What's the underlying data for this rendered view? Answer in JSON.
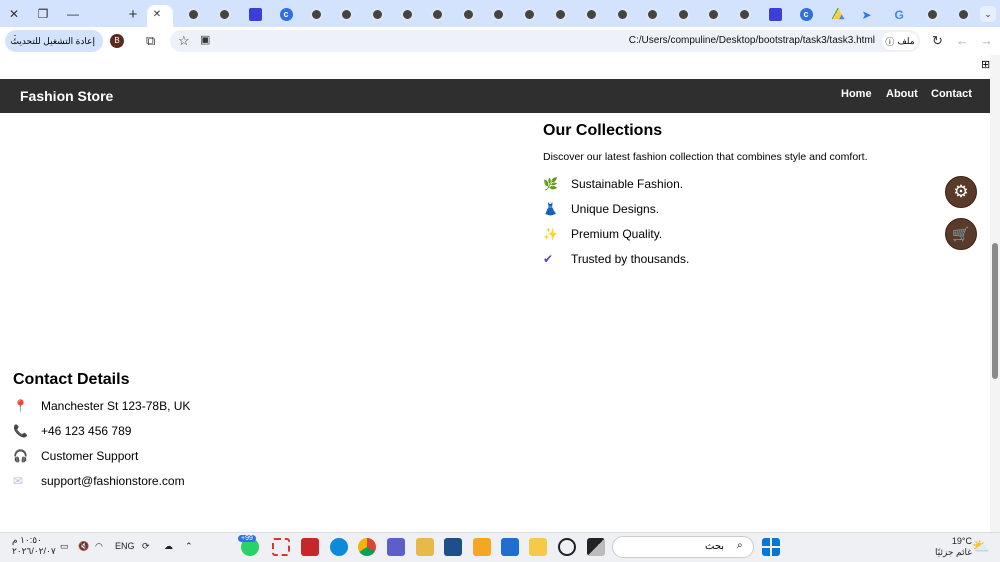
{
  "browser": {
    "window_controls": {
      "close": "✕",
      "restore": "❐",
      "minimize": "—",
      "new_tab": "+"
    },
    "active_tab_close": "✕",
    "tabs": [
      "globe",
      "globe",
      "extension",
      "c-app",
      "globe",
      "globe",
      "globe",
      "globe",
      "globe",
      "globe",
      "globe",
      "globe",
      "globe",
      "globe",
      "globe",
      "globe",
      "globe",
      "globe",
      "globe",
      "extension",
      "c-app",
      "drive",
      "bird",
      "google",
      "globe",
      "globe"
    ],
    "reload_chip": "إعادة التشغيل للتحديث",
    "profile_initial": "B",
    "url": "C:/Users/compuline/Desktop/bootstrap/task3/task3.html",
    "site_info": "ملف"
  },
  "navbar": {
    "brand": "Fashion Store",
    "links": [
      "Home",
      "About",
      "Contact"
    ]
  },
  "collections": {
    "title": "Our Collections",
    "description": "Discover our latest fashion collection that combines style and comfort.",
    "items": [
      {
        "icon": "🌿",
        "label": "Sustainable Fashion.",
        "color": "#6aa84f"
      },
      {
        "icon": "👗",
        "label": "Unique Designs.",
        "color": "#2f6fd8"
      },
      {
        "icon": "✨",
        "label": "Premium Quality.",
        "color": "#f2a33a"
      },
      {
        "icon": "✔",
        "label": "Trusted by thousands.",
        "color": "#5b3fc4"
      }
    ]
  },
  "contact": {
    "title": "Contact Details",
    "items": [
      {
        "icon": "📍",
        "label": "Manchester St 123-78B, UK",
        "color": "#e0245e"
      },
      {
        "icon": "📞",
        "label": "+46 123 456 789",
        "color": "#d6246e"
      },
      {
        "icon": "🎧",
        "label": "Customer Support",
        "color": "#777"
      },
      {
        "icon": "✉",
        "label": "support@fashionstore.com",
        "color": "#c9b4e0"
      }
    ]
  },
  "fabs": {
    "settings": "⚙",
    "cart": "🛒"
  },
  "taskbar": {
    "clock_time": "١٠:٥٠ م",
    "clock_date": "٢٠٢٦/٠٢/٠٧",
    "language": "ENG",
    "whatsapp_badge": "+99",
    "search_placeholder": "بحث",
    "weather_temp": "19°C",
    "weather_desc": "غائم جزئيًا"
  },
  "colors": {
    "navbar": "#2f2f2f",
    "fab": "#5a3a28",
    "tabbar": "#d3e3fd"
  }
}
